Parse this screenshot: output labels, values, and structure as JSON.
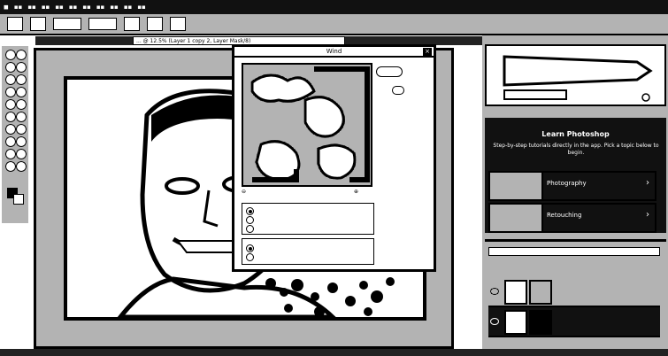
{
  "menubar": {
    "items": [
      "",
      "",
      "",
      "",
      "",
      "",
      "",
      "",
      "",
      ""
    ]
  },
  "options": {
    "field1": "",
    "field2": ""
  },
  "document_tab": {
    "title": "... @ 12.5% (Layer 1 copy 2, Layer Mask/8)"
  },
  "dialog": {
    "title": "Wind",
    "ok_label": "",
    "method_options": [
      {
        "label": "",
        "selected": true
      },
      {
        "label": "",
        "selected": false
      },
      {
        "label": "",
        "selected": false
      }
    ],
    "direction_options": [
      {
        "label": "",
        "selected": true
      },
      {
        "label": "",
        "selected": false
      }
    ]
  },
  "learn": {
    "title": "Learn Photoshop",
    "description": "Step-by-step tutorials directly in the app. Pick a topic below to begin.",
    "cards": [
      {
        "label": "Photography"
      },
      {
        "label": "Retouching"
      }
    ]
  },
  "layers": {
    "rows": [
      {
        "name": ""
      },
      {
        "name": ""
      }
    ]
  },
  "colors": {
    "background": "#ffffff",
    "ink": "#000000",
    "panel_dark": "#333333"
  },
  "icons": [
    "close-icon",
    "eye-icon",
    "chevron-right-icon"
  ]
}
